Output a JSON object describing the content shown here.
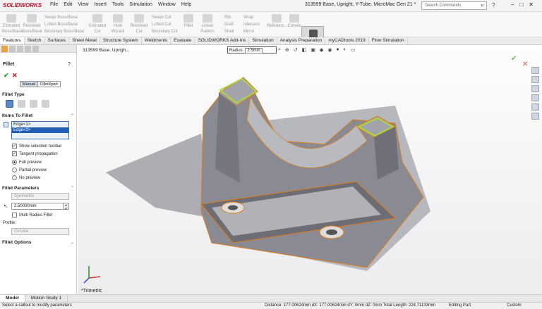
{
  "app": {
    "logo": "SOLIDWORKS",
    "title": "313599 Base, Upright, Y-Tube, MicroMac Gen 21 *",
    "search_placeholder": "Search Commands"
  },
  "menu": [
    "File",
    "Edit",
    "View",
    "Insert",
    "Tools",
    "Simulation",
    "Window",
    "Help"
  ],
  "ribbon": {
    "extruded_boss": "Extruded Boss/Base",
    "revolved_boss": "Revolved Boss/Base",
    "swept_boss": "Swept Boss/Base",
    "lofted_boss": "Lofted Boss/Base",
    "boundary_boss": "Boundary Boss/Base",
    "extruded_cut": "Extruded Cut",
    "hole_wizard": "Hole Wizard",
    "revolved_cut": "Revolved Cut",
    "swept_cut": "Swept Cut",
    "lofted_cut": "Lofted Cut",
    "boundary_cut": "Boundary Cut",
    "fillet": "Fillet",
    "linear_pattern": "Linear Pattern",
    "rib": "Rib",
    "draft": "Draft",
    "shell": "Shell",
    "wrap": "Wrap",
    "intersect": "Intersect",
    "mirror": "Mirror",
    "reference": "Referenc...",
    "curves": "Curves",
    "instant3d": "Instant3D"
  },
  "tabs": [
    "Features",
    "Sketch",
    "Surfaces",
    "Sheet Metal",
    "Structure System",
    "Weldments",
    "Evaluate",
    "SOLIDWORKS Add-Ins",
    "Simulation",
    "Analysis Preparation",
    "myCADtools 2019",
    "Flow Simulation"
  ],
  "panel": {
    "title": "Fillet",
    "manual": "Manual",
    "filletxpert": "FilletXpert",
    "fillet_type": "Fillet Type",
    "items_to_fillet": "Items To Fillet",
    "items": [
      "Edge<1>",
      "Edge<2>"
    ],
    "show_selection_toolbar": "Show selection toolbar",
    "tangent_propagation": "Tangent propagation",
    "full_preview": "Full preview",
    "partial_preview": "Partial preview",
    "no_preview": "No preview",
    "fillet_parameters": "Fillet Parameters",
    "symmetric": "Symmetric",
    "radius_value": "2.50000mm",
    "multi_radius": "Multi Radius Fillet",
    "profile": "Profile:",
    "circular": "Circular",
    "fillet_options": "Fillet Options"
  },
  "viewport": {
    "tree_title": "313599 Base, Uprigh...",
    "radius_label": "Radius:",
    "radius_value": "2.5mm",
    "view_name": "*Trimetric"
  },
  "bottom_tabs": [
    "Model",
    "Motion Study 1"
  ],
  "status": {
    "hint": "Select a callout to modify parameters",
    "distance": "Distance: 177.00624mm dX: 177.00624mm dY: 0mm dZ: 0mm Total Length: 224.71133mm",
    "mode": "Editing Part",
    "units": "Custom"
  },
  "colors": {
    "highlight": "#1f5fb3",
    "model": "#8a8b92",
    "edge": "#e07b17",
    "select_green": "#a9d63a"
  }
}
